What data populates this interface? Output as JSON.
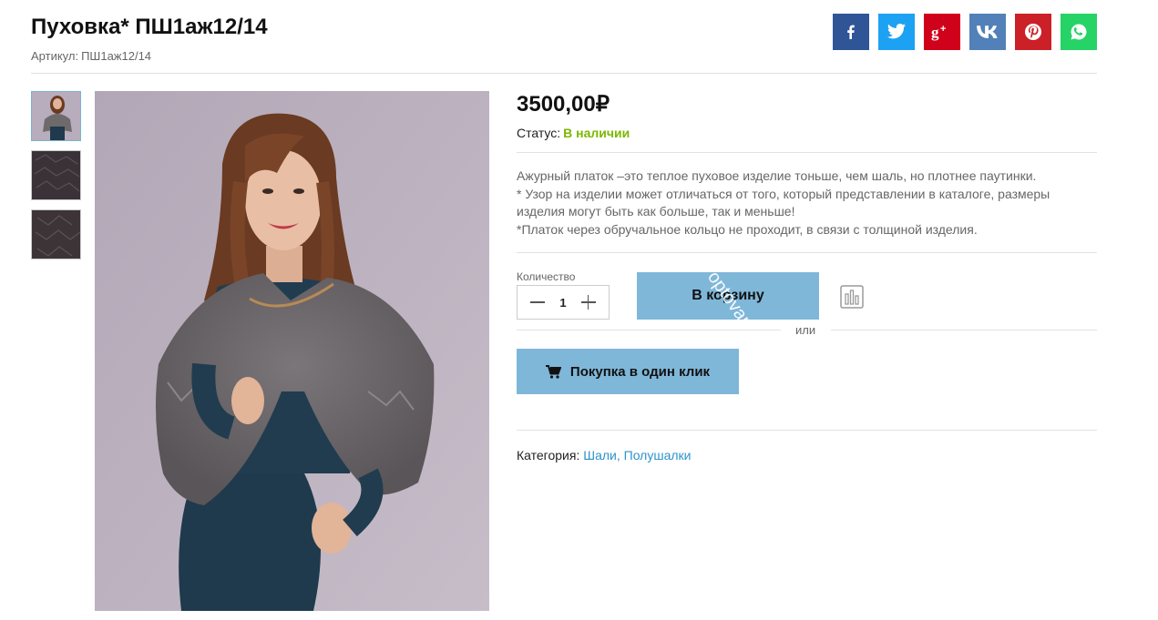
{
  "product": {
    "title": "Пуховка* ПШ1аж12/14",
    "sku_label": "Артикул:",
    "sku_value": "ПШ1аж12/14",
    "price": "3500,00₽",
    "status_label": "Статус:",
    "status_value": "В наличии",
    "status_color": "#7cb800",
    "description": [
      "Ажурный платок –это теплое пуховое изделие тоньше, чем шаль, но плотнее паутинки.",
      "* Узор на изделии может отличаться от того, который представлении в каталоге, размеры",
      "изделия могут быть как больше, так и меньше!",
      "*Платок через обручальное кольцо не проходит, в связи с толщиной изделия."
    ]
  },
  "share": [
    {
      "name": "facebook",
      "icon": "facebook-icon",
      "color": "#2f5597"
    },
    {
      "name": "twitter",
      "icon": "twitter-icon",
      "color": "#1da1f2"
    },
    {
      "name": "google-plus",
      "icon": "google-plus-icon",
      "color": "#d0021b"
    },
    {
      "name": "vk",
      "icon": "vk-icon",
      "color": "#5181b8"
    },
    {
      "name": "pinterest",
      "icon": "pinterest-icon",
      "color": "#cb2027"
    },
    {
      "name": "whatsapp",
      "icon": "whatsapp-icon",
      "color": "#25d366"
    }
  ],
  "purchase": {
    "quantity_label": "Количество",
    "quantity_value": "1",
    "add_to_cart_label": "В корзину",
    "watermark": "optovar",
    "or_label": "или",
    "one_click_label": "Покупка в один клик",
    "one_click_icon": "cart-icon",
    "compare_icon": "compare-icon",
    "button_color": "#7fb7d9"
  },
  "category": {
    "label": "Категория:",
    "link_1": "Шали",
    "separator": ",",
    "link_2": "Полушалки",
    "link_color": "#2e93c9"
  },
  "gallery": {
    "thumbnails": [
      "model-photo",
      "shawl-texture",
      "shawl-texture"
    ],
    "active_index": 0
  }
}
